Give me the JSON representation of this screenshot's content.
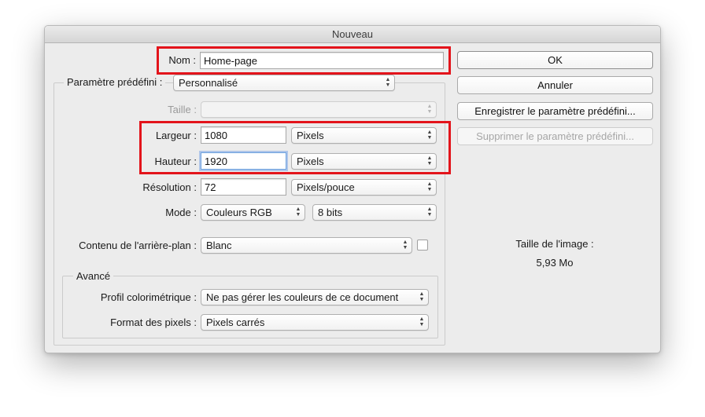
{
  "dialog": {
    "title": "Nouveau"
  },
  "name": {
    "label": "Nom :",
    "value": "Home-page"
  },
  "preset": {
    "label": "Paramètre prédéfini :",
    "value": "Personnalisé",
    "size_label": "Taille :",
    "size_value": ""
  },
  "dimensions": {
    "width_label": "Largeur :",
    "width_value": "1080",
    "width_unit": "Pixels",
    "height_label": "Hauteur :",
    "height_value": "1920",
    "height_unit": "Pixels"
  },
  "resolution": {
    "label": "Résolution :",
    "value": "72",
    "unit": "Pixels/pouce"
  },
  "mode": {
    "label": "Mode :",
    "color_mode": "Couleurs RGB",
    "bit_depth": "8 bits"
  },
  "background": {
    "label": "Contenu de l'arrière-plan :",
    "value": "Blanc"
  },
  "advanced": {
    "title": "Avancé",
    "profile_label": "Profil colorimétrique :",
    "profile_value": "Ne pas gérer les couleurs de ce document",
    "pixel_format_label": "Format des pixels :",
    "pixel_format_value": "Pixels carrés"
  },
  "buttons": {
    "ok": "OK",
    "cancel": "Annuler",
    "save_preset": "Enregistrer le paramètre prédéfini...",
    "delete_preset": "Supprimer le paramètre prédéfini..."
  },
  "image_size": {
    "label": "Taille de l'image :",
    "value": "5,93 Mo"
  },
  "colors": {
    "highlight": "#e3141b",
    "focus_ring": "#6da2e0"
  },
  "icons": {
    "popup_arrows": "updown-arrows-icon"
  }
}
